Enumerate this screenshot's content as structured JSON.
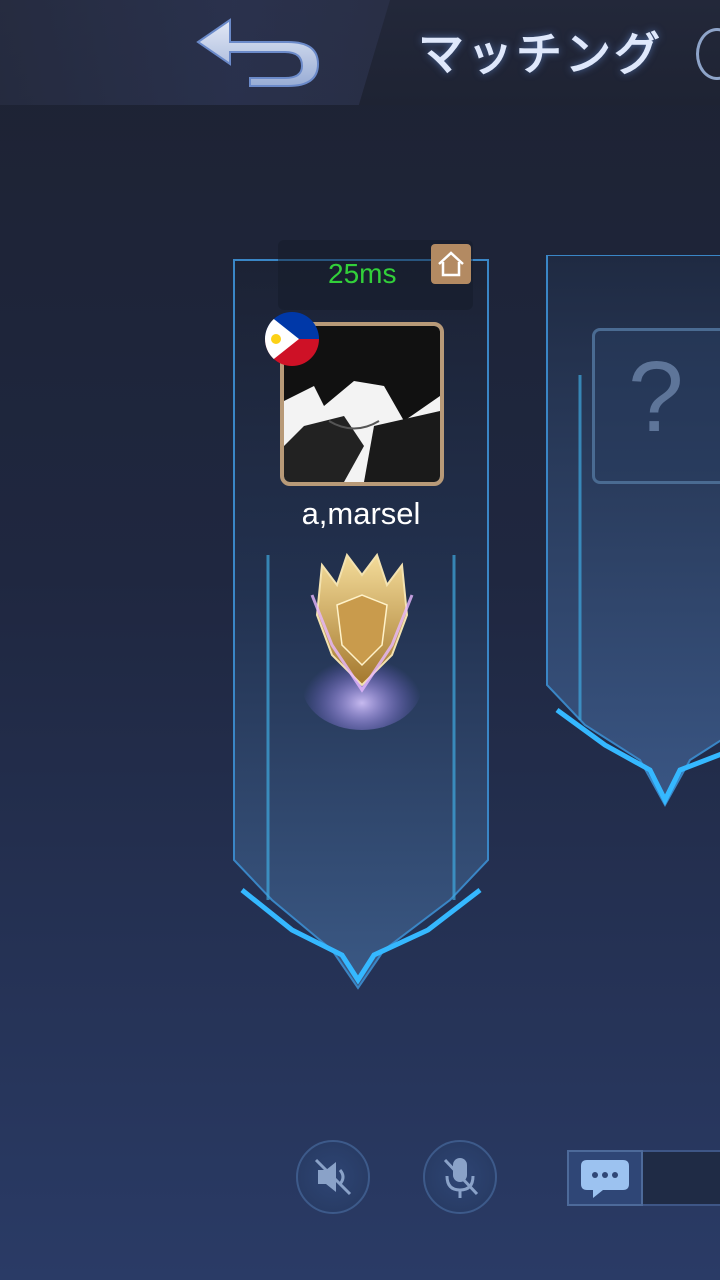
{
  "header": {
    "title": "マッチング",
    "back_icon": "back-arrow-icon",
    "refresh_icon": "refresh-icon"
  },
  "player": {
    "ping": "25ms",
    "name": "a,marsel",
    "flag_icon": "philippines-flag-icon",
    "home_icon": "home-icon",
    "rank_icon": "mythic-rank-badge-icon"
  },
  "empty_slot": {
    "placeholder": "?"
  },
  "bottom_controls": {
    "speaker_icon": "speaker-muted-icon",
    "mic_icon": "mic-muted-icon",
    "chat_icon": "chat-bubble-icon"
  },
  "colors": {
    "ping": "#32d03a",
    "card_border": "#3fa9e0",
    "accent_gold": "#b89a78"
  }
}
